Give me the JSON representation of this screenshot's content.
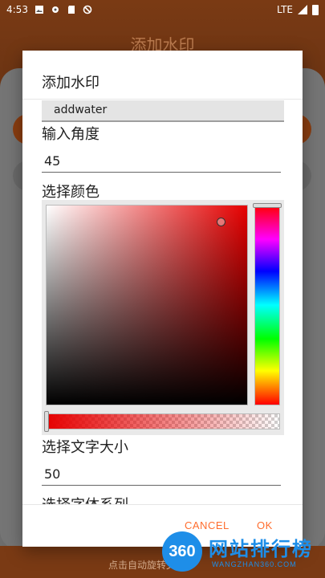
{
  "status_bar": {
    "time": "4:53",
    "network": "LTE"
  },
  "background_app": {
    "title": "添加水印",
    "bottom_text": "点击自动旋转文件"
  },
  "dialog": {
    "title": "添加水印",
    "watermark_text": "addwater",
    "angle_label": "输入角度",
    "angle_value": "45",
    "color_label": "选择颜色",
    "selected_color": "#e60000",
    "text_size_label": "选择文字大小",
    "text_size_value": "50",
    "font_family_label": "选择字体系列",
    "cancel_label": "CANCEL",
    "ok_label": "OK"
  },
  "watermark": {
    "logo": "360",
    "brand": "网站排行榜",
    "url": "WANGZHAN360.COM"
  },
  "colors": {
    "accent": "#ff6d2e",
    "brand_brown": "#7a3a14",
    "watermark_blue": "#1e8ee8"
  }
}
